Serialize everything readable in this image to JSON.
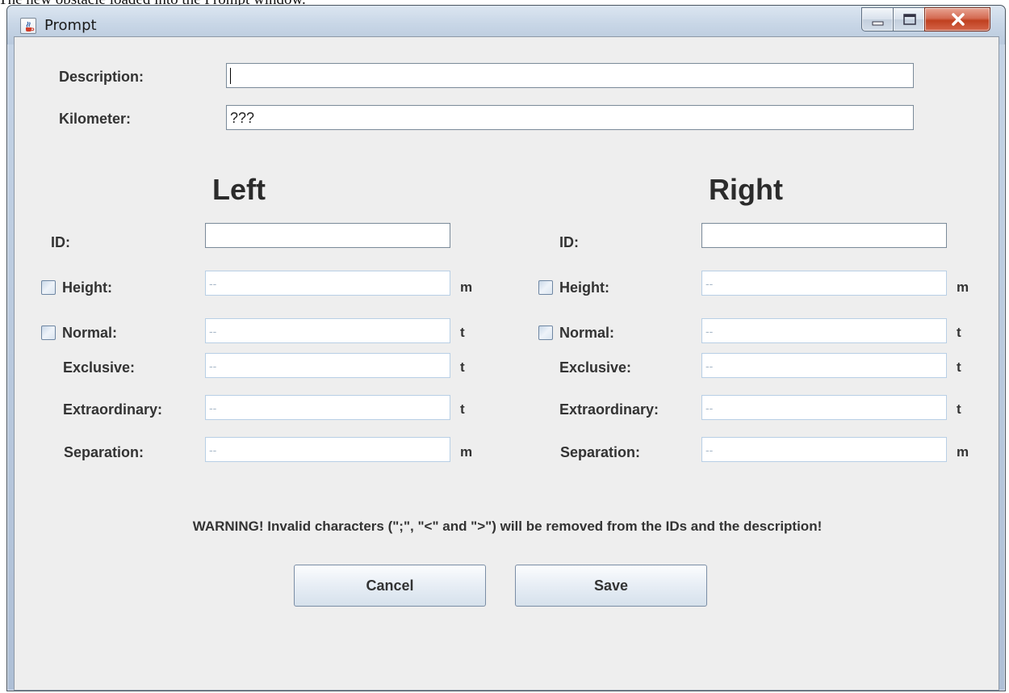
{
  "caption": "The new obstacle loaded into the Prompt window.",
  "window": {
    "title": "Prompt",
    "controls": {
      "minimize": "minimize",
      "maximize": "maximize",
      "close": "close"
    }
  },
  "form": {
    "description_label": "Description:",
    "description_value": "",
    "kilometer_label": "Kilometer:",
    "kilometer_value": "???"
  },
  "left": {
    "heading": "Left",
    "id_label": "ID:",
    "id_value": "",
    "height_label": "Height:",
    "height_checked": false,
    "height_value": "--",
    "height_unit": "m",
    "normal_label": "Normal:",
    "normal_checked": false,
    "normal_value": "--",
    "normal_unit": "t",
    "exclusive_label": "Exclusive:",
    "exclusive_value": "--",
    "exclusive_unit": "t",
    "extraordinary_label": "Extraordinary:",
    "extraordinary_value": "--",
    "extraordinary_unit": "t",
    "separation_label": "Separation:",
    "separation_value": "--",
    "separation_unit": "m"
  },
  "right": {
    "heading": "Right",
    "id_label": "ID:",
    "id_value": "",
    "height_label": "Height:",
    "height_checked": false,
    "height_value": "--",
    "height_unit": "m",
    "normal_label": "Normal:",
    "normal_checked": false,
    "normal_value": "--",
    "normal_unit": "t",
    "exclusive_label": "Exclusive:",
    "exclusive_value": "--",
    "exclusive_unit": "t",
    "extraordinary_label": "Extraordinary:",
    "extraordinary_value": "--",
    "extraordinary_unit": "t",
    "separation_label": "Separation:",
    "separation_value": "--",
    "separation_unit": "m"
  },
  "warning": "WARNING! Invalid characters (\";\", \"<\" and \">\") will be removed from the IDs and the description!",
  "buttons": {
    "cancel": "Cancel",
    "save": "Save"
  },
  "icons": {
    "app": "java-coffee-cup-icon"
  },
  "colors": {
    "client_background": "#eeeeee",
    "close_button": "#c0401f",
    "disabled_field_border": "#b8cfe5",
    "label_text": "#333333"
  }
}
